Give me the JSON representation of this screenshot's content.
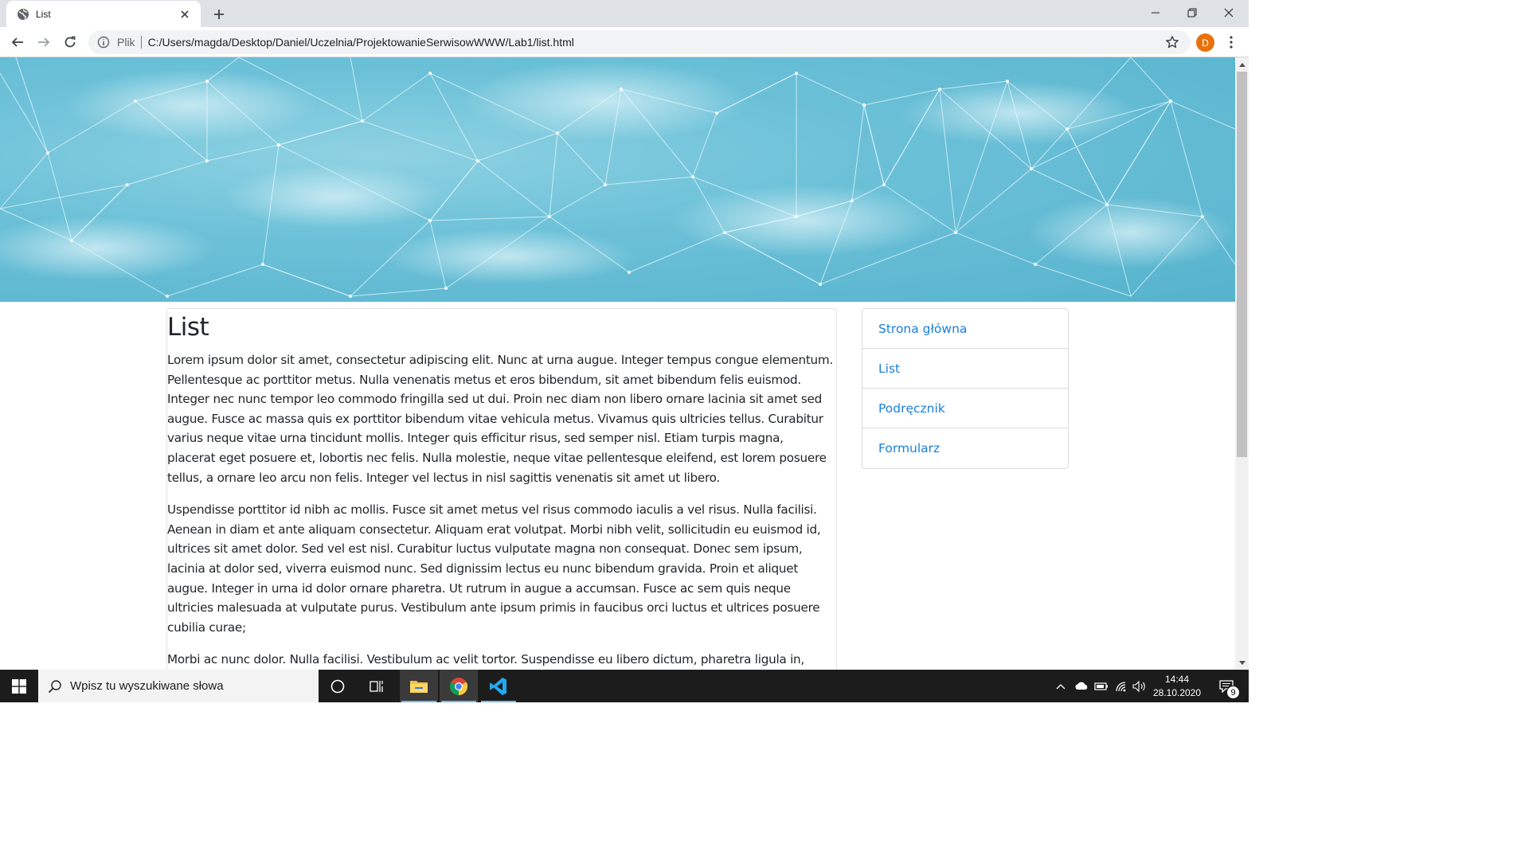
{
  "browser": {
    "tab_title": "List",
    "address_prefix": "Plik",
    "url": "C:/Users/magda/Desktop/Daniel/Uczelnia/ProjektowanieSerwisowWWW/Lab1/list.html",
    "profile_initial": "D",
    "profile_color": "#e8710a"
  },
  "page": {
    "heading": "List",
    "paragraphs": [
      "Lorem ipsum dolor sit amet, consectetur adipiscing elit. Nunc at urna augue. Integer tempus congue elementum. Pellentesque ac porttitor metus. Nulla venenatis metus et eros bibendum, sit amet bibendum felis euismod. Integer nec nunc tempor leo commodo fringilla sed ut dui. Proin nec diam non libero ornare lacinia sit amet sed augue. Fusce ac massa quis ex porttitor bibendum vitae vehicula metus. Vivamus quis ultricies tellus. Curabitur varius neque vitae urna tincidunt mollis. Integer quis efficitur risus, sed semper nisl. Etiam turpis magna, placerat eget posuere et, lobortis nec felis. Nulla molestie, neque vitae pellentesque eleifend, est lorem posuere tellus, a ornare leo arcu non felis. Integer vel lectus in nisl sagittis venenatis sit amet ut libero.",
      "Uspendisse porttitor id nibh ac mollis. Fusce sit amet metus vel risus commodo iaculis a vel risus. Nulla facilisi. Aenean in diam et ante aliquam consectetur. Aliquam erat volutpat. Morbi nibh velit, sollicitudin eu euismod id, ultrices sit amet dolor. Sed vel est nisl. Curabitur luctus vulputate magna non consequat. Donec sem ipsum, lacinia at dolor sed, viverra euismod nunc. Sed dignissim lectus eu nunc bibendum gravida. Proin et aliquet augue. Integer in urna id dolor ornare pharetra. Ut rutrum in augue a accumsan. Fusce ac sem quis neque ultricies malesuada at vulputate purus. Vestibulum ante ipsum primis in faucibus orci luctus et ultrices posuere cubilia curae;",
      "Morbi ac nunc dolor. Nulla facilisi. Vestibulum ac velit tortor. Suspendisse eu libero dictum, pharetra ligula in, placerat dolor. Suspendisse potenti. Integer euismod, dolor a scelerisque efficitur, justo nulla interdum enim, a"
    ],
    "nav": [
      {
        "label": "Strona główna"
      },
      {
        "label": "List"
      },
      {
        "label": "Podręcznik"
      },
      {
        "label": "Formularz"
      }
    ],
    "link_color": "#1a7fdb",
    "banner_color": "#5bb7d0"
  },
  "taskbar": {
    "search_placeholder": "Wpisz tu wyszukiwane słowa",
    "time": "14:44",
    "date": "28.10.2020",
    "notification_count": "9"
  }
}
